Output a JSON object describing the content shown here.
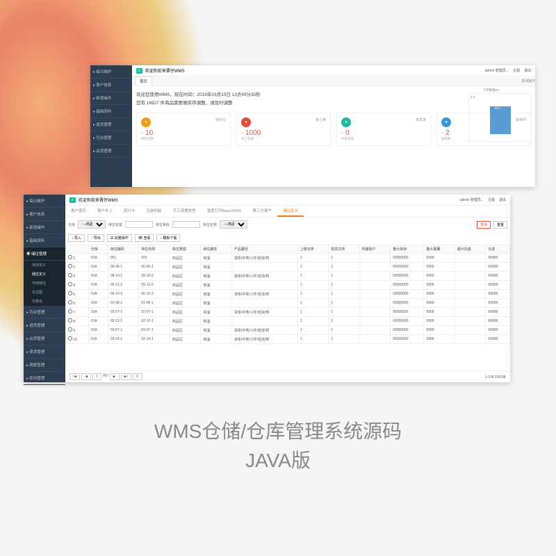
{
  "title": {
    "line1": "WMS仓储/仓库管理系统源码",
    "line2": "JAVA版"
  },
  "topbar": {
    "welcome": "欢迎你前来晋仔WMS",
    "user": "admin 管理员...",
    "theme": "主题",
    "exit": "退出",
    "home": "首页",
    "close_ops": "关闭操作"
  },
  "win1": {
    "sidebar": [
      "每日维护",
      "客户信息",
      "新增操作",
      "基础资料",
      "退货管理",
      "月台管理",
      "出货管理"
    ],
    "welcome_msg": "欢迎您使用WMS，现在时间：2019年03月15日 13点49分35秒",
    "notice": "您有 16927 件商品需要做库存调整，请及时调整",
    "stats": [
      {
        "label": "待定位",
        "value": "10",
        "sub": "待定位数"
      },
      {
        "label": "待上架",
        "value": "1000",
        "sub": "待上架数"
      },
      {
        "label": "待发货",
        "value": "0",
        "sub": "待发货数"
      },
      {
        "label": "复核中",
        "value": "2",
        "sub": "复核数"
      }
    ],
    "chart": {
      "title": "下单数量BV",
      "axis_max": "2.5",
      "bar_label": "10.0"
    }
  },
  "win2": {
    "sidebar_top": [
      "每日维护",
      "客户信息",
      "新增操作",
      "基础资料"
    ],
    "sidebar_active": "储位管理",
    "sidebar_sub": [
      "库存定义",
      "储位定义",
      "可用储位",
      "仓位图",
      "交接设"
    ],
    "sidebar_bottom": [
      "月台管理",
      "进货管理",
      "出货管理",
      "退货管理",
      "调度管理",
      "库内管理"
    ],
    "tabs": [
      "客户保存",
      "客户补上",
      "库行卡",
      "注册初始",
      "手工调理类型",
      "温度打印Base20000",
      "第三方客户",
      "储位定义"
    ],
    "active_tab": "储位定义",
    "filters": {
      "warehouse": "仓库",
      "product": "—商品—",
      "loc_label": "库位标签",
      "loc_code": "库位条码",
      "loc_name": "库位名称",
      "product2": "—商品—"
    },
    "actions": {
      "import": "导入",
      "export": "导出",
      "batch": "批量操作",
      "view": "查看",
      "template": "模板下载",
      "search": "查询",
      "reset": "重置"
    },
    "columns": [
      "",
      "仓库",
      "库位编码",
      "库位名称",
      "库位类型",
      "库位属性",
      "产品属性",
      "上架次序",
      "取货次序",
      "所属客户",
      "最大库存",
      "最大重量",
      "最大托盘",
      "长度"
    ],
    "rows": [
      [
        "1",
        "01A",
        "001",
        "001",
        "商品区",
        "常温",
        "货柜/中类/小件/轻货/附",
        "1",
        "1",
        "",
        "00000000",
        "9999",
        "",
        "99999"
      ],
      [
        "2",
        "01A",
        "06-06-1",
        "06-06-1",
        "商品区",
        "常温",
        "",
        "1",
        "1",
        "",
        "00000000",
        "9999",
        "",
        "99999"
      ],
      [
        "3",
        "01A",
        "08-10-2",
        "08-10-2",
        "商品区",
        "常温",
        "货柜/中类/小件/轻货/附",
        "1",
        "1",
        "",
        "00000000",
        "9999",
        "",
        "99999"
      ],
      [
        "4",
        "01A",
        "05-12-2",
        "05-12-2",
        "商品区",
        "常温",
        "",
        "1",
        "1",
        "",
        "00000000",
        "9999",
        "",
        "99999"
      ],
      [
        "5",
        "01A",
        "06-10-3",
        "06-10-3",
        "商品区",
        "常温",
        "货柜/中类/小件/轻货/附",
        "1",
        "1",
        "",
        "00000000",
        "9999",
        "",
        "99999"
      ],
      [
        "6",
        "01A",
        "01-08-1",
        "01-08-1",
        "商品区",
        "常温",
        "",
        "1",
        "1",
        "",
        "00000000",
        "9999",
        "",
        "99999"
      ],
      [
        "7",
        "01A",
        "02-07-1",
        "02-07-1",
        "商品区",
        "常温",
        "货柜/中类/小件/轻货/附",
        "1",
        "1",
        "",
        "00000000",
        "9999",
        "",
        "99999"
      ],
      [
        "8",
        "01A",
        "02-12-1",
        "02-12-1",
        "商品区",
        "常温",
        "",
        "1",
        "1",
        "",
        "00000000",
        "9999",
        "",
        "99999"
      ],
      [
        "9",
        "01A",
        "03-07-1",
        "03-07-1",
        "商品区",
        "常温",
        "货柜/中类/小件/轻货/附",
        "1",
        "1",
        "",
        "00000000",
        "9999",
        "",
        "99999"
      ],
      [
        "10",
        "01A",
        "02-14-1",
        "02-14-1",
        "商品区",
        "常温",
        "货柜/中类/小件/轻货/附",
        "1",
        "1",
        "",
        "00000000",
        "9999",
        "",
        "99999"
      ]
    ],
    "pager": {
      "page": "1",
      "total_pages": "月0",
      "info": "1-108 1005条"
    }
  }
}
